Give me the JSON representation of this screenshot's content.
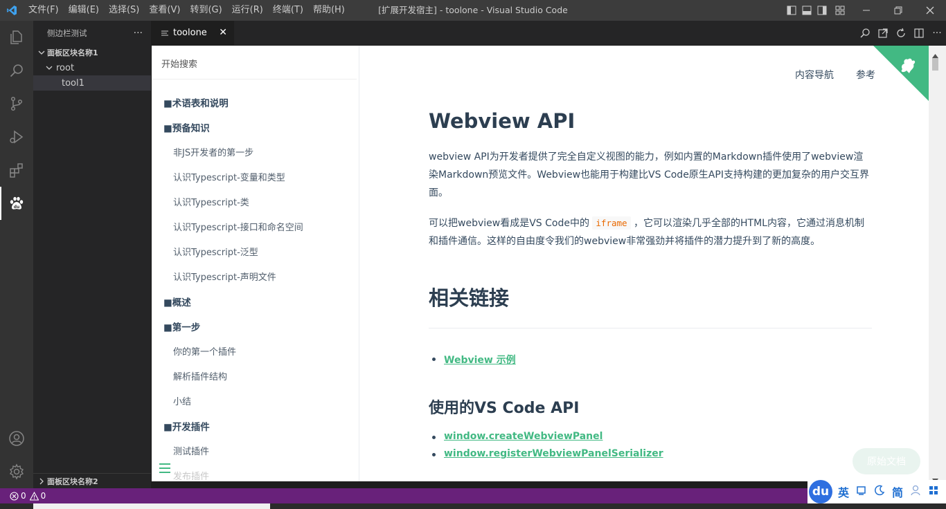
{
  "titlebar": {
    "menu": [
      "文件(F)",
      "编辑(E)",
      "选择(S)",
      "查看(V)",
      "转到(G)",
      "运行(R)",
      "终端(T)",
      "帮助(H)"
    ],
    "title": "[扩展开发宿主] - toolone - Visual Studio Code"
  },
  "sidebar": {
    "title": "侧边栏测试",
    "more": "···",
    "section1": "面板区块名称1",
    "root_label": "root",
    "child_label": "tool1",
    "section2": "面板区块名称2"
  },
  "editor": {
    "tab_label": "toolone",
    "tab_close": "✕"
  },
  "docs_sidebar": {
    "search_placeholder": "开始搜索",
    "nav": [
      {
        "kind": "grp",
        "label": "■术语表和说明"
      },
      {
        "kind": "grp",
        "label": "■预备知识"
      },
      {
        "kind": "itm",
        "label": "非JS开发者的第一步"
      },
      {
        "kind": "itm",
        "label": "认识Typescript-变量和类型"
      },
      {
        "kind": "itm",
        "label": "认识Typescript-类"
      },
      {
        "kind": "itm",
        "label": "认识Typescript-接口和命名空间"
      },
      {
        "kind": "itm",
        "label": "认识Typescript-泛型"
      },
      {
        "kind": "itm",
        "label": "认识Typescript-声明文件"
      },
      {
        "kind": "grp",
        "label": "■概述"
      },
      {
        "kind": "grp",
        "label": "■第一步"
      },
      {
        "kind": "itm",
        "label": "你的第一个插件"
      },
      {
        "kind": "itm",
        "label": "解析插件结构"
      },
      {
        "kind": "itm",
        "label": "小结"
      },
      {
        "kind": "grp",
        "label": "■开发插件"
      },
      {
        "kind": "itm",
        "label": "测试插件"
      },
      {
        "kind": "itm fade",
        "label": "发布插件"
      }
    ]
  },
  "content": {
    "topnav": [
      "内容导航",
      "参考"
    ],
    "h1": "Webview API",
    "p1": "webview API为开发者提供了完全自定义视图的能力，例如内置的Markdown插件使用了webview渲染Markdown预览文件。Webview也能用于构建比VS Code原生API支持构建的更加复杂的用户交互界面。",
    "p2_before": "可以把webview看成是VS Code中的 ",
    "p2_code": "iframe",
    "p2_after": " ，它可以渲染几乎全部的HTML内容，它通过消息机制和插件通信。这样的自由度令我们的webview非常强劲并将插件的潜力提升到了新的高度。",
    "h2": "相关链接",
    "link1": "Webview 示例",
    "h3": "使用的VS Code API",
    "link2": "window.createWebviewPanel",
    "link3": "window.registerWebviewPanelSerializer",
    "orig_button": "原始文档"
  },
  "status": {
    "errors": "0",
    "warnings": "0"
  },
  "ime": {
    "logo": "du",
    "items": [
      "英",
      "简"
    ]
  },
  "colors": {
    "statusbar": "#68217a",
    "accent_green": "#42b983",
    "heading": "#2c3e50"
  }
}
